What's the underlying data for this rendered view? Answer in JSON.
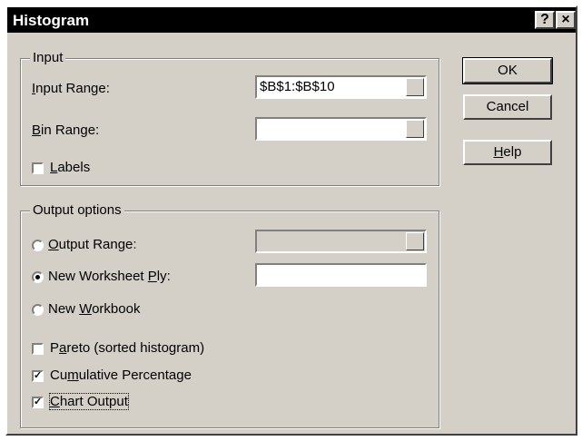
{
  "window": {
    "title": "Histogram",
    "help_glyph": "?",
    "close_glyph": "×"
  },
  "input": {
    "group_label": "Input",
    "input_range_label": "Input Range:",
    "input_range_value": "$B$1:$B$10",
    "bin_range_label": "Bin Range:",
    "bin_range_value": "",
    "labels_label": "Labels",
    "labels_checked": false
  },
  "output": {
    "group_label": "Output options",
    "output_range_label": "Output Range:",
    "output_range_value": "",
    "new_ply_label": "New Worksheet Ply:",
    "new_ply_value": "",
    "new_workbook_label": "New Workbook",
    "selected": "new_ply",
    "pareto_label": "Pareto (sorted histogram)",
    "pareto_checked": false,
    "cumulative_label": "Cumulative Percentage",
    "cumulative_checked": true,
    "chart_label": "Chart Output",
    "chart_checked": true,
    "check_glyph": "✓"
  },
  "buttons": {
    "ok": "OK",
    "cancel": "Cancel",
    "help": "Help"
  }
}
